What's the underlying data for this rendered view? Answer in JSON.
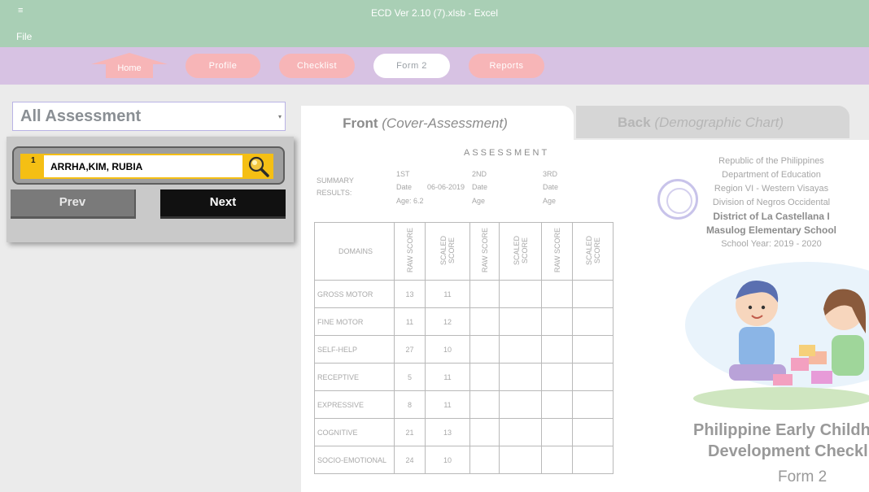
{
  "titlebar": {
    "menu_icon": "≡",
    "title": "ECD Ver 2.10 (7).xlsb - Excel",
    "file_menu": "File"
  },
  "nav": {
    "home": "Home",
    "profile": "Profile",
    "checklist": "Checklist",
    "form2": "Form 2",
    "reports": "Reports"
  },
  "assessment_select": {
    "value": "All Assessment",
    "arrow": "▾"
  },
  "search": {
    "row_number": "1",
    "value": "ARRHA,KIM, RUBIA",
    "prev_label": "Prev",
    "next_label": "Next"
  },
  "tabs": {
    "front_main": "Front",
    "front_sub": "(Cover-Assessment)",
    "back_main": "Back",
    "back_sub": "(Demographic Chart)"
  },
  "sheet": {
    "assessment_title": "ASSESSMENT",
    "summary_label_1": "SUMMARY",
    "summary_label_2": "RESULTS:",
    "cols": [
      {
        "ord": "1ST",
        "date_label": "Date",
        "date_value": "06-06-2019",
        "age": "Age: 6.2"
      },
      {
        "ord": "2ND",
        "date_label": "Date",
        "date_value": "",
        "age": "Age"
      },
      {
        "ord": "3RD",
        "date_label": "Date",
        "date_value": "",
        "age": "Age"
      }
    ],
    "table_headers": [
      "DOMAINS",
      "RAW SCORE",
      "SCALED SCORE",
      "RAW SCORE",
      "SCALED SCORE",
      "RAW SCORE",
      "SCALED SCORE"
    ],
    "rows": [
      {
        "domain": "GROSS MOTOR",
        "raw": "13",
        "scaled": "11"
      },
      {
        "domain": "FINE MOTOR",
        "raw": "11",
        "scaled": "12"
      },
      {
        "domain": "SELF-HELP",
        "raw": "27",
        "scaled": "10"
      },
      {
        "domain": "RECEPTIVE",
        "raw": "5",
        "scaled": "11"
      },
      {
        "domain": "EXPRESSIVE",
        "raw": "8",
        "scaled": "11"
      },
      {
        "domain": "COGNITIVE",
        "raw": "21",
        "scaled": "13"
      },
      {
        "domain": "SOCIO-EMOTIONAL",
        "raw": "24",
        "scaled": "10"
      }
    ],
    "right_header": [
      "Republic of the Philippines",
      "Department of Education",
      "Region VI - Western Visayas",
      "Division of Negros Occidental"
    ],
    "district": "District of La Castellana I",
    "school": "Masulog Elementary School",
    "school_year": "School Year: 2019 - 2020",
    "big_title_1": "Philippine Early Childhood",
    "big_title_2": "Development Checklist",
    "form_label": "Form 2"
  },
  "colors": {
    "titlebar": "#a9cfb5",
    "navbar": "#d7c2e3",
    "nav_pill": "#f7b5b7",
    "search_accent": "#f5bf14"
  }
}
